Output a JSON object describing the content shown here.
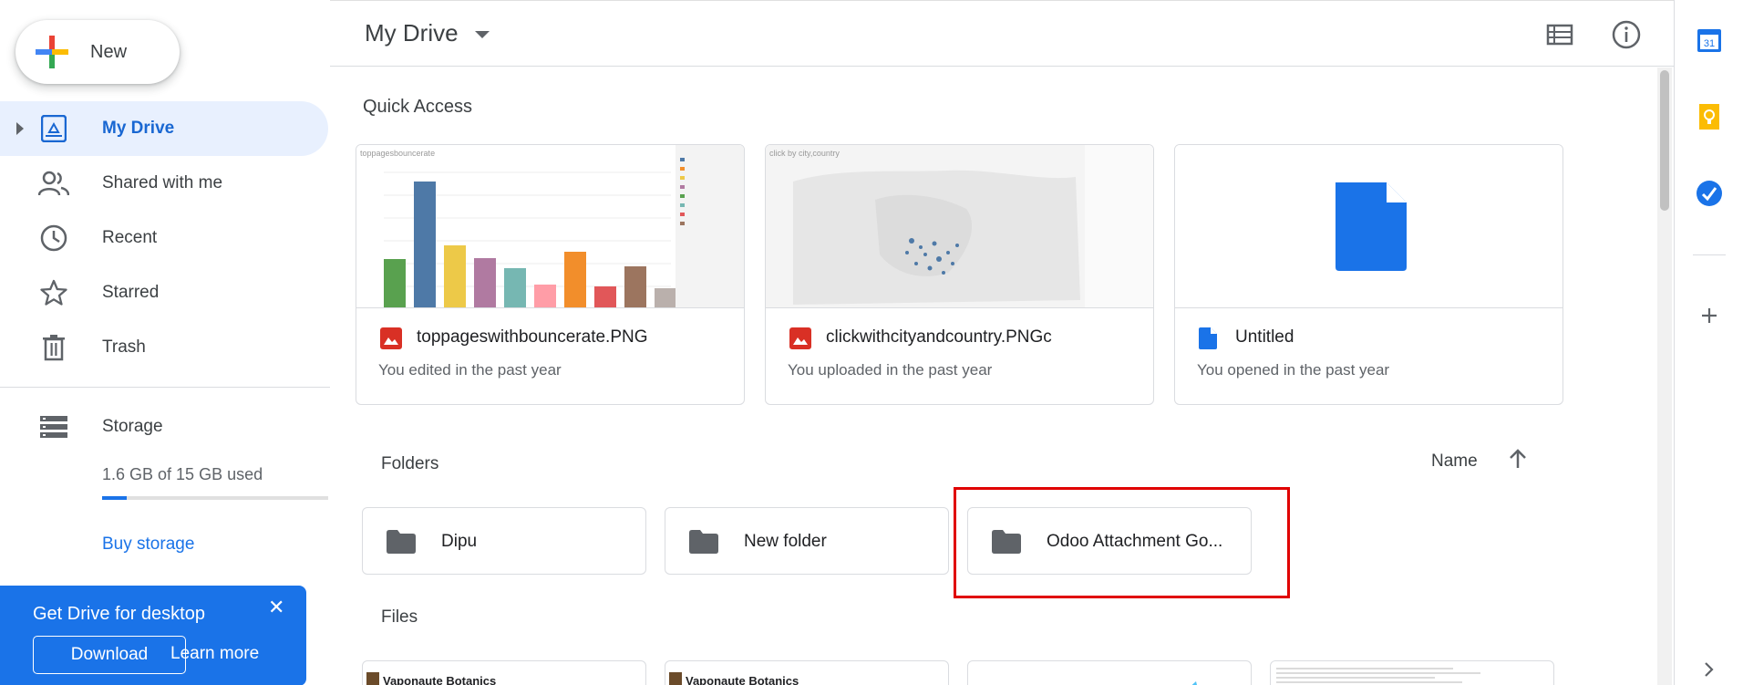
{
  "new_button": {
    "label": "New"
  },
  "sidebar": {
    "items": [
      {
        "label": "My Drive",
        "icon": "drive-icon"
      },
      {
        "label": "Shared with me",
        "icon": "people-icon"
      },
      {
        "label": "Recent",
        "icon": "clock-icon"
      },
      {
        "label": "Starred",
        "icon": "star-icon"
      },
      {
        "label": "Trash",
        "icon": "trash-icon"
      }
    ],
    "storage": {
      "label": "Storage",
      "used_text": "1.6 GB of 15 GB used",
      "used_fraction": 0.107,
      "buy_label": "Buy storage"
    }
  },
  "promo": {
    "title": "Get Drive for desktop",
    "close": "✕",
    "download_label": "Download",
    "learn_more_label": "Learn more"
  },
  "header": {
    "title": "My Drive"
  },
  "quick_access": {
    "title": "Quick Access",
    "cards": [
      {
        "name": "toppageswithbouncerate.PNG",
        "subtitle": "You edited in the past year",
        "type": "image",
        "thumb_caption": "toppagesbouncerate"
      },
      {
        "name": "clickwithcityandcountry.PNGc",
        "subtitle": "You uploaded in the past year",
        "type": "image",
        "thumb_caption": "click by city,country"
      },
      {
        "name": "Untitled",
        "subtitle": "You opened in the past year",
        "type": "doc"
      }
    ]
  },
  "folders": {
    "title": "Folders",
    "sort_label": "Name",
    "items": [
      {
        "name": "Dipu"
      },
      {
        "name": "New folder"
      },
      {
        "name": "Odoo Attachment Go..."
      }
    ]
  },
  "files": {
    "title": "Files",
    "items": [
      {
        "name": "Vaponaute Botanics"
      },
      {
        "name": "Vaponaute Botanics"
      }
    ]
  },
  "colors": {
    "accent": "#1a73e8",
    "active_bg": "#e8f0fe",
    "highlight": "#e00000",
    "promo_bg": "#1a73e8",
    "image_icon": "#d93025"
  }
}
